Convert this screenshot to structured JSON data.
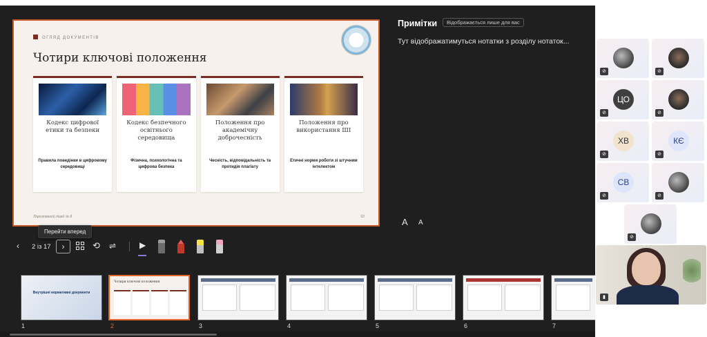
{
  "slide": {
    "tagline": "ОГЛЯД ДОКУМЕНТІВ",
    "title": "Чотири ключові положення",
    "footer_left": "Ліцензований ліцей № 8",
    "footer_right": "02",
    "cards": [
      {
        "title": "Кодекс цифрової етики та безпеки",
        "subtitle": "Правила поведінки в цифровому середовищі"
      },
      {
        "title": "Кодекс безпечного освітнього середовища",
        "subtitle": "Фізична, психологічна та цифрова безпека"
      },
      {
        "title": "Положення про академічну доброчесність",
        "subtitle": "Чесність, відповідальність та протидія плагіату"
      },
      {
        "title": "Положення про використання ШІ",
        "subtitle": "Етичні норми роботи зі штучним інтелектом"
      }
    ]
  },
  "notes": {
    "title": "Примітки",
    "badge": "Відображається лише для вас",
    "text": "Тут відображатимуться нотатки з розділу нотаток...",
    "font_up": "A",
    "font_down": "A"
  },
  "tooltip": "Перейти вперед",
  "toolbar": {
    "prev_icon": "‹",
    "counter": "2 із 17",
    "next_icon": "›",
    "loop_icon": "⟲",
    "settings_icon": "⇌",
    "pointer_icon": "▶"
  },
  "thumbnails": [
    {
      "number": "1",
      "label": "Внутрішні нормативні документи"
    },
    {
      "number": "2",
      "label": "Чотири ключові положення"
    },
    {
      "number": "3",
      "label": ""
    },
    {
      "number": "4",
      "label": ""
    },
    {
      "number": "5",
      "label": ""
    },
    {
      "number": "6",
      "label": ""
    },
    {
      "number": "7",
      "label": ""
    }
  ],
  "participants": [
    {
      "initials": "",
      "kind": "photo"
    },
    {
      "initials": "",
      "kind": "photo"
    },
    {
      "initials": "ЦО",
      "kind": "initials",
      "bg": "#3f3f3f",
      "color": "#ffffff"
    },
    {
      "initials": "",
      "kind": "photo"
    },
    {
      "initials": "ХВ",
      "kind": "initials",
      "bg": "#f2e3cf",
      "color": "#333333"
    },
    {
      "initials": "КЄ",
      "kind": "initials",
      "bg": "#dfe6fb",
      "color": "#2a3f8a"
    },
    {
      "initials": "СВ",
      "kind": "initials",
      "bg": "#dbe6fb",
      "color": "#2a3f8a"
    },
    {
      "initials": "",
      "kind": "photo"
    },
    {
      "initials": "",
      "kind": "photo"
    }
  ],
  "colors": {
    "accent": "#e0662a",
    "slide_border": "#c85a2a",
    "card_bar": "#7a2b22",
    "stage_bg": "#201f1f"
  }
}
